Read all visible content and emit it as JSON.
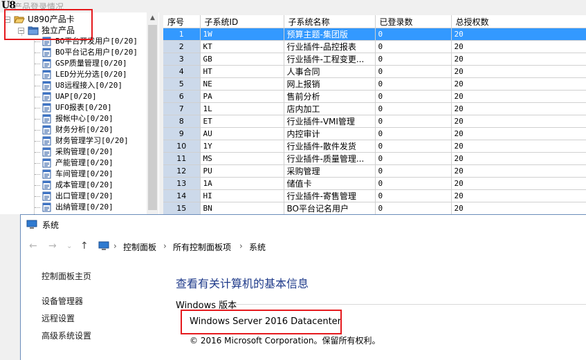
{
  "app": {
    "logo": "U8",
    "title": "产品登录情况"
  },
  "tree": {
    "nodes": [
      {
        "label": "U890产品卡",
        "level": 0,
        "icon": "open-folder-icon",
        "expanded": true
      },
      {
        "label": "独立产品",
        "level": 1,
        "icon": "folder-icon",
        "expanded": true
      },
      {
        "label": "BO平台开发用户[0/20]",
        "level": 2,
        "icon": "document-icon"
      },
      {
        "label": "BO平台记名用户[0/20]",
        "level": 2,
        "icon": "document-icon"
      },
      {
        "label": "GSP质量管理[0/20]",
        "level": 2,
        "icon": "document-icon"
      },
      {
        "label": "LED分光分选[0/20]",
        "level": 2,
        "icon": "document-icon"
      },
      {
        "label": "U8远程接入[0/20]",
        "level": 2,
        "icon": "document-icon"
      },
      {
        "label": "UAP[0/20]",
        "level": 2,
        "icon": "document-icon"
      },
      {
        "label": "UFO报表[0/20]",
        "level": 2,
        "icon": "document-icon"
      },
      {
        "label": "报帐中心[0/20]",
        "level": 2,
        "icon": "document-icon"
      },
      {
        "label": "财务分析[0/20]",
        "level": 2,
        "icon": "document-icon"
      },
      {
        "label": "财务管理学习[0/20]",
        "level": 2,
        "icon": "document-icon"
      },
      {
        "label": "采购管理[0/20]",
        "level": 2,
        "icon": "document-icon"
      },
      {
        "label": "产能管理[0/20]",
        "level": 2,
        "icon": "document-icon"
      },
      {
        "label": "车间管理[0/20]",
        "level": 2,
        "icon": "document-icon"
      },
      {
        "label": "成本管理[0/20]",
        "level": 2,
        "icon": "document-icon"
      },
      {
        "label": "出口管理[0/20]",
        "level": 2,
        "icon": "document-icon"
      },
      {
        "label": "出納管理[0/20]",
        "level": 2,
        "icon": "document-icon"
      }
    ]
  },
  "grid": {
    "columns": [
      "序号",
      "子系统ID",
      "子系统名称",
      "已登录数",
      "总授权数"
    ],
    "selected_row": 0,
    "rows": [
      [
        "1",
        "1W",
        "预算主题-集团版",
        "0",
        "20"
      ],
      [
        "2",
        "KT",
        "行业插件-品控报表",
        "0",
        "20"
      ],
      [
        "3",
        "GB",
        "行业插件-工程变更...",
        "0",
        "20"
      ],
      [
        "4",
        "HT",
        "人事合同",
        "0",
        "20"
      ],
      [
        "5",
        "NE",
        "网上报销",
        "0",
        "20"
      ],
      [
        "6",
        "PA",
        "售前分析",
        "0",
        "20"
      ],
      [
        "7",
        "1L",
        "店内加工",
        "0",
        "20"
      ],
      [
        "8",
        "ET",
        "行业插件-VMI管理",
        "0",
        "20"
      ],
      [
        "9",
        "AU",
        "内控审计",
        "0",
        "20"
      ],
      [
        "10",
        "1Y",
        "行业插件-散件发货",
        "0",
        "20"
      ],
      [
        "11",
        "MS",
        "行业插件-质量管理...",
        "0",
        "20"
      ],
      [
        "12",
        "PU",
        "采购管理",
        "0",
        "20"
      ],
      [
        "13",
        "1A",
        "储值卡",
        "0",
        "20"
      ],
      [
        "14",
        "HI",
        "行业插件-寄售管理",
        "0",
        "20"
      ],
      [
        "15",
        "BN",
        "BO平台记名用户",
        "0",
        "20"
      ]
    ]
  },
  "system": {
    "title": "系统",
    "breadcrumb": [
      "控制面板",
      "所有控制面板项",
      "系统"
    ],
    "left_links": [
      "控制面板主页",
      "设备管理器",
      "远程设置",
      "高级系统设置"
    ],
    "heading": "查看有关计算机的基本信息",
    "windows_version_label": "Windows 版本",
    "edition": "Windows Server 2016 Datacenter",
    "copyright": "© 2016 Microsoft Corporation。保留所有权利。"
  },
  "colors": {
    "selection": "#3399ff",
    "row_header": "#ccd9ea",
    "highlight_box": "#e5191d",
    "link_heading": "#1e3a8a"
  }
}
